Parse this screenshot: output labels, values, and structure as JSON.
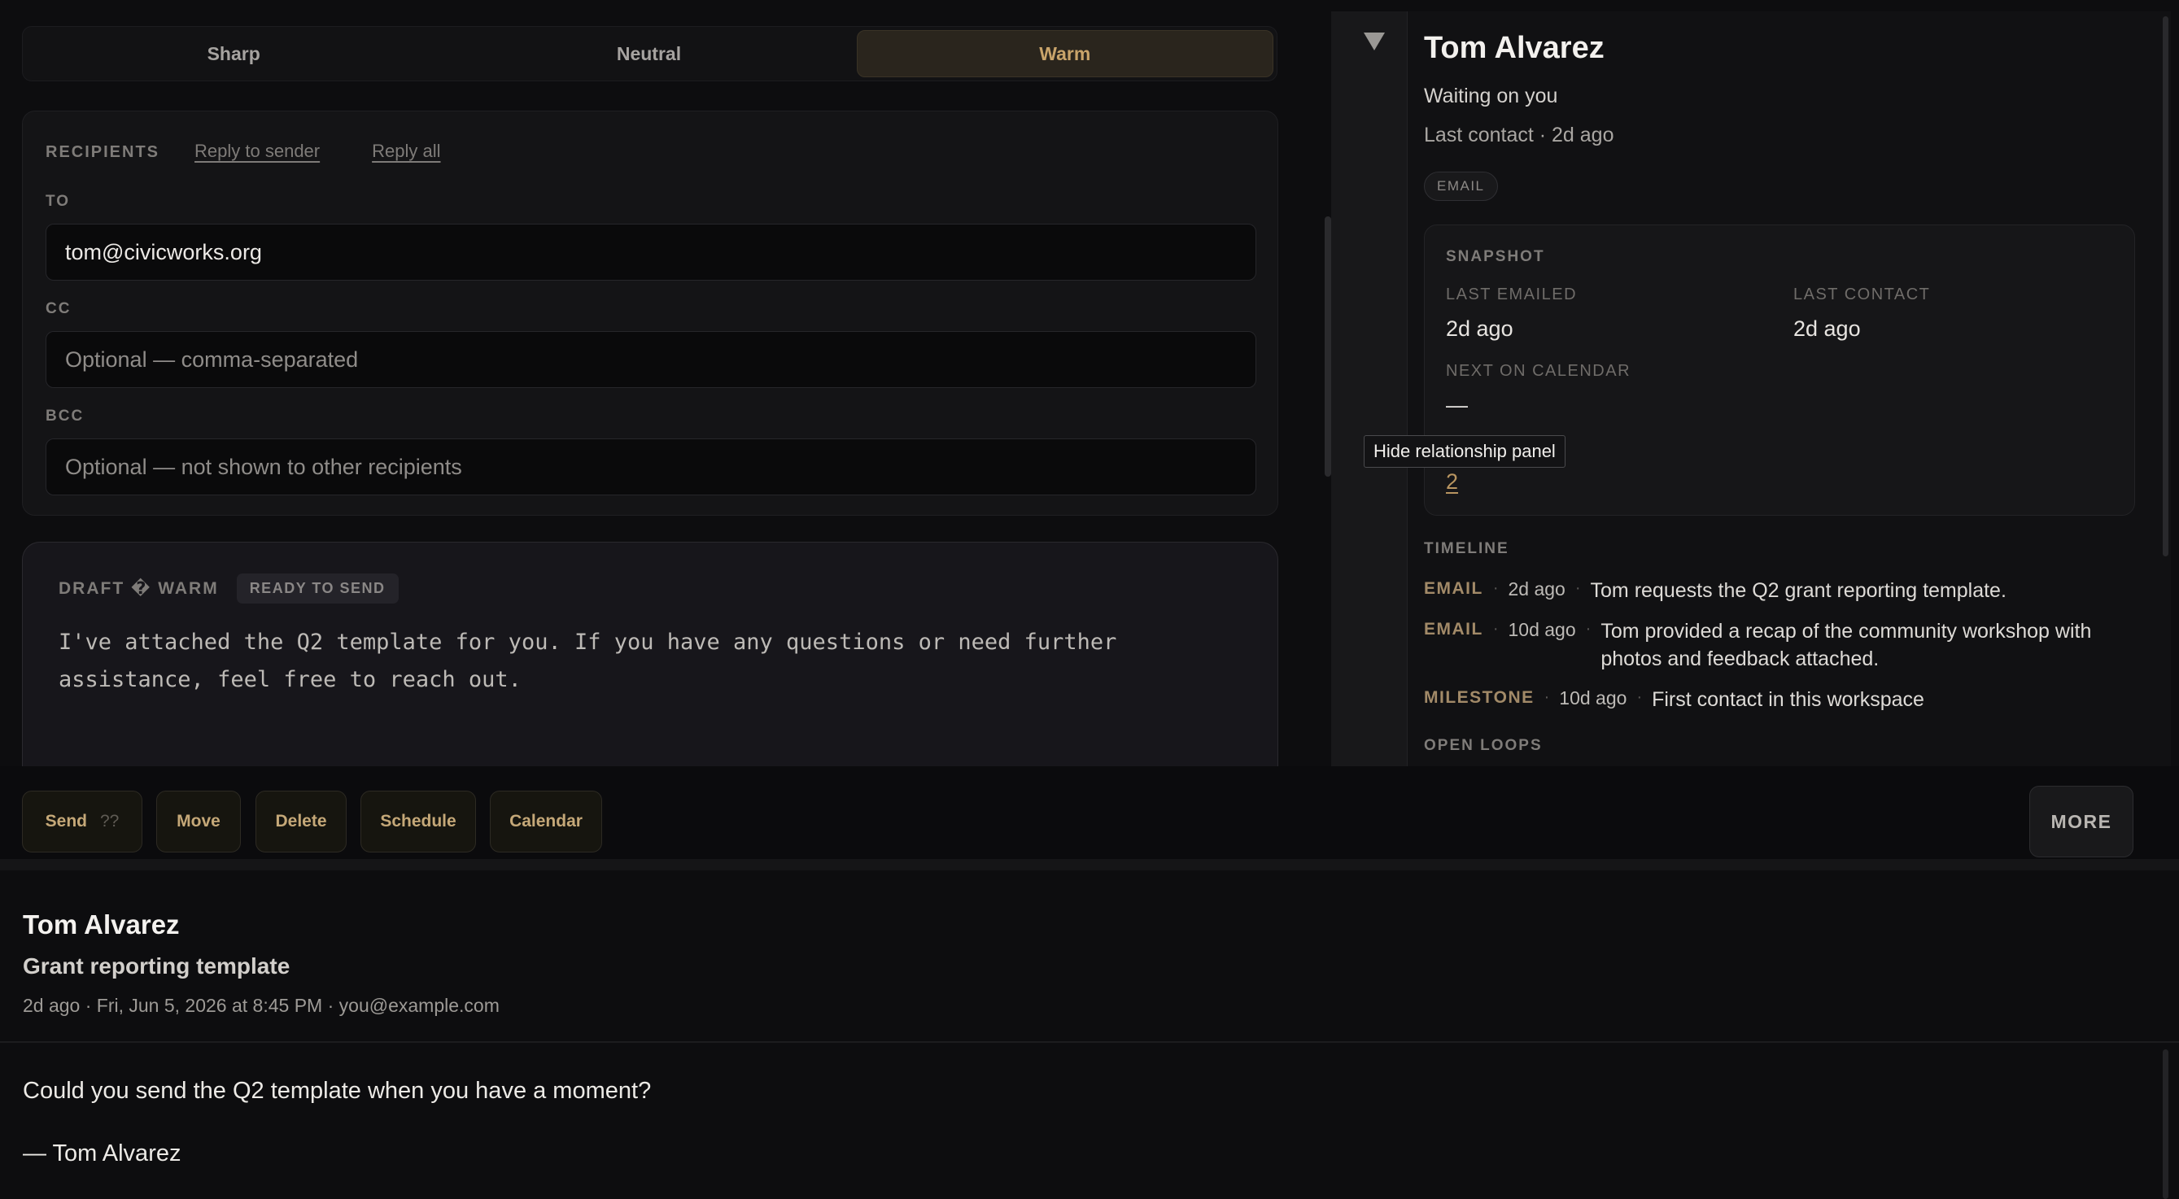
{
  "tone": {
    "options": [
      "Sharp",
      "Neutral",
      "Warm"
    ],
    "selected": "Warm"
  },
  "recipients": {
    "title": "RECIPIENTS",
    "reply_sender": "Reply to sender",
    "reply_all": "Reply all",
    "to_label": "TO",
    "to_value": "tom@civicworks.org",
    "cc_label": "CC",
    "cc_placeholder": "Optional — comma-separated",
    "bcc_label": "BCC",
    "bcc_placeholder": "Optional — not shown to other recipients"
  },
  "draft": {
    "title": "DRAFT � WARM",
    "badge": "READY TO SEND",
    "body": "I've attached the Q2 template for you. If you have any questions or need further assistance, feel free to reach out."
  },
  "actions": {
    "send": "Send",
    "send_shortcut": "??",
    "move": "Move",
    "delete": "Delete",
    "schedule": "Schedule",
    "calendar": "Calendar",
    "more": "MORE"
  },
  "relationship": {
    "name": "Tom Alvarez",
    "status": "Waiting on you",
    "last_contact": "Last contact · 2d ago",
    "tag": "EMAIL",
    "tooltip": "Hide relationship panel",
    "snapshot": {
      "title": "SNAPSHOT",
      "last_emailed_label": "LAST EMAILED",
      "last_emailed_value": "2d ago",
      "last_contact_label": "LAST CONTACT",
      "last_contact_value": "2d ago",
      "next_calendar_label": "NEXT ON CALENDAR",
      "next_calendar_value": "—",
      "link_value": "2"
    },
    "timeline_title": "TIMELINE",
    "timeline": [
      {
        "kind": "EMAIL",
        "time": "2d ago",
        "text": "Tom requests the Q2 grant reporting template."
      },
      {
        "kind": "EMAIL",
        "time": "10d ago",
        "text": "Tom provided a recap of the community workshop with photos and feedback attached."
      },
      {
        "kind": "MILESTONE",
        "time": "10d ago",
        "text": "First contact in this workspace"
      }
    ],
    "open_loops_title": "OPEN LOOPS"
  },
  "message": {
    "from": "Tom Alvarez",
    "subject": "Grant reporting template",
    "meta": "2d ago · Fri, Jun 5, 2026 at 8:45 PM · you@example.com",
    "body": "Could you send the Q2 template when you have a moment?",
    "signature": "— Tom Alvarez"
  },
  "colors": {
    "accent": "#c9a46a",
    "background": "#0d0d0f",
    "panel": "#141416"
  }
}
